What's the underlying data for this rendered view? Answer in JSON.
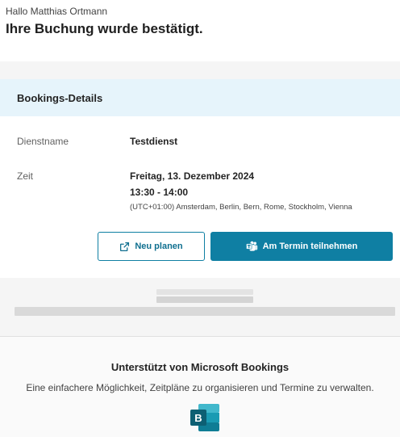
{
  "header": {
    "greeting": "Hallo Matthias Ortmann",
    "headline": "Ihre Buchung wurde bestätigt."
  },
  "details": {
    "title": "Bookings-Details",
    "service_label": "Dienstname",
    "service_value": "Testdienst",
    "time_label": "Zeit",
    "date": "Freitag, 13. Dezember 2024",
    "time_range": "13:30 - 14:00",
    "timezone": "(UTC+01:00) Amsterdam, Berlin, Bern, Rome, Stockholm, Vienna"
  },
  "actions": {
    "reschedule_label": "Neu planen",
    "reschedule_icon": "external-link-icon",
    "join_label": "Am Termin teilnehmen",
    "join_icon": "teams-icon"
  },
  "footer": {
    "powered_by": "Unterstützt von Microsoft Bookings",
    "tagline": "Eine einfachere Möglichkeit, Zeitpläne zu organisieren und Termine zu verwalten.",
    "logo_icon": "microsoft-bookings-logo"
  },
  "colors": {
    "accent": "#0f7fa3",
    "details_header_bg": "#e6f4fb",
    "section_bg": "#f5f5f5"
  }
}
